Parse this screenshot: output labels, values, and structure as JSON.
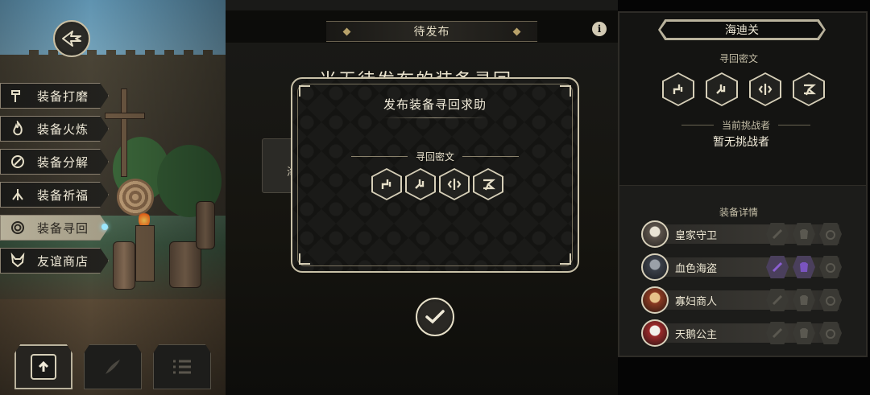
{
  "menu": {
    "items": [
      {
        "label": "装备打磨",
        "icon": "hammer-icon"
      },
      {
        "label": "装备火炼",
        "icon": "flame-icon"
      },
      {
        "label": "装备分解",
        "icon": "split-icon"
      },
      {
        "label": "装备祈福",
        "icon": "pray-hands-icon"
      },
      {
        "label": "装备寻回",
        "icon": "spiral-icon"
      },
      {
        "label": "友谊商店",
        "icon": "fox-icon"
      }
    ],
    "active": "装备寻回"
  },
  "header": {
    "pending_tab": "待发布",
    "background_text": "当无待发布的装备寻回",
    "background_card_char": "海"
  },
  "modal": {
    "title": "发布装备寻回求助",
    "cipher_label": "寻回密文",
    "runes": [
      "rune-1-icon",
      "rune-2-icon",
      "rune-3-icon",
      "rune-4-icon"
    ]
  },
  "right_panel": {
    "stage": "海迪关",
    "cipher_label": "寻回密文",
    "runes": [
      "rune-1-icon",
      "rune-2-icon",
      "rune-3-icon",
      "rune-4-icon"
    ],
    "challenger_label": "当前挑战者",
    "challenger_value": "暂无挑战者",
    "equip_label": "装备详情",
    "equipment": [
      {
        "name": "皇家守卫",
        "highlight": false
      },
      {
        "name": "血色海盗",
        "highlight": true
      },
      {
        "name": "寡妇商人",
        "highlight": false
      },
      {
        "name": "天鹅公主",
        "highlight": false
      }
    ]
  },
  "colors": {
    "gold_border": "#c9c1a8",
    "panel_dark": "#141412",
    "highlight_purple": "#6a4fa0"
  }
}
